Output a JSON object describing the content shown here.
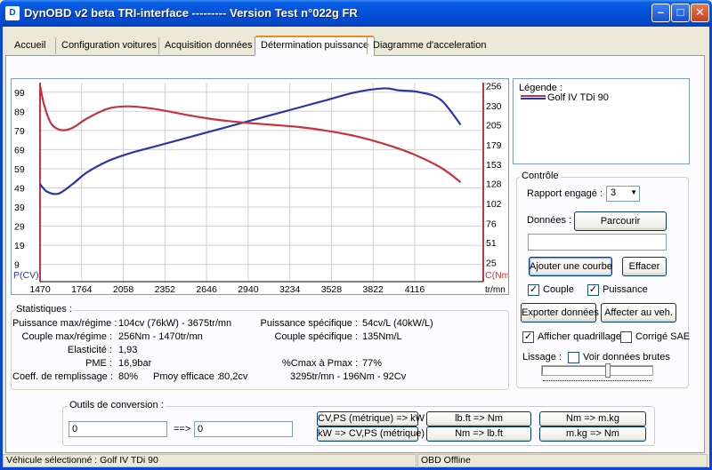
{
  "window": {
    "title": "DynOBD v2 beta TRI-interface --------- Version Test n°022g FR",
    "app_icon": "dyno-app-icon"
  },
  "tabs": [
    {
      "label": "Accueil"
    },
    {
      "label": "Configuration voitures"
    },
    {
      "label": "Acquisition données"
    },
    {
      "label": "Détermination puissance",
      "active": true
    },
    {
      "label": "Diagramme d'acceleration"
    }
  ],
  "chart_data": {
    "type": "line",
    "x_ticks": [
      1470,
      1764,
      2058,
      2352,
      2646,
      2940,
      3234,
      3528,
      3822,
      4116
    ],
    "x_unit": "tr/mn",
    "y_left_ticks": [
      99,
      89,
      79,
      69,
      59,
      49,
      39,
      29,
      19,
      9
    ],
    "y_left_label": "P(CV)",
    "y_right_ticks": [
      256,
      230,
      205,
      179,
      153,
      128,
      102,
      76,
      51,
      25
    ],
    "y_right_label": "C(Nm)",
    "xlim": [
      1470,
      4600
    ],
    "ylim_left": [
      0,
      104
    ],
    "ylim_right": [
      0,
      260
    ],
    "series": [
      {
        "color": "#2c36a8",
        "axis": "left",
        "x": [
          1470,
          1520,
          1600,
          1700,
          1800,
          1950,
          2100,
          2300,
          2500,
          2700,
          2900,
          3100,
          3300,
          3500,
          3700,
          3900,
          4000,
          4150,
          4300,
          4440
        ],
        "y": [
          51,
          47,
          46,
          51,
          57,
          63,
          67,
          71,
          75,
          79,
          83,
          87,
          91,
          95,
          99,
          101,
          100,
          99,
          95,
          82
        ]
      },
      {
        "color": "#c8323c",
        "axis": "right",
        "x": [
          1470,
          1500,
          1550,
          1620,
          1700,
          1800,
          1950,
          2100,
          2300,
          2500,
          2700,
          2900,
          3100,
          3300,
          3500,
          3700,
          3900,
          4100,
          4300,
          4440
        ],
        "y": [
          256,
          230,
          206,
          198,
          201,
          213,
          226,
          229,
          225,
          218,
          212,
          208,
          205,
          202,
          197,
          190,
          180,
          167,
          149,
          130
        ]
      }
    ]
  },
  "legend": {
    "title": "Légende :",
    "entry": "Golf IV TDi 90"
  },
  "controle": {
    "title": "Contrôle",
    "rapport_label": "Rapport engagé :",
    "rapport_value": "3",
    "donnees_label": "Données :",
    "parcourir": "Parcourir",
    "file_value": "",
    "ajouter": "Ajouter une courbe",
    "effacer": "Effacer",
    "couple_label": "Couple",
    "couple_checked": true,
    "puissance_label": "Puissance",
    "puissance_checked": true,
    "exporter": "Exporter données",
    "affecter": "Affecter au veh.",
    "quadrillage_label": "Afficher quadrillage",
    "quadrillage_checked": true,
    "sae_label": "Corrigé SAE",
    "sae_checked": false,
    "lissage_label": "Lissage :",
    "brutes_label": "Voir données brutes",
    "brutes_checked": false
  },
  "stats": {
    "title": "Statistiques :",
    "puissance_max_label": "Puissance max/régime :",
    "puissance_max": "104cv (76kW) - 3675tr/mn",
    "couple_max_label": "Couple max/régime :",
    "couple_max": "256Nm - 1470tr/mn",
    "elasticite_label": "Elasticité :",
    "elasticite": "1,93",
    "pme_label": "PME :",
    "pme": "16,9bar",
    "coeff_label": "Coeff. de remplissage :",
    "coeff": "80%",
    "pmoy_label": "Pmoy efficace :",
    "pmoy": "80,2cv",
    "puiss_spec_label": "Puissance spécifique :",
    "puiss_spec": "54cv/L (40kW/L)",
    "couple_spec_label": "Couple spécifique :",
    "couple_spec": "135Nm/L",
    "cmax_pmax_label": "%Cmax à Pmax :",
    "cmax_pmax": "77%",
    "extra": "3295tr/mn - 196Nm - 92Cv"
  },
  "conversion": {
    "title": "Outils de conversion :",
    "input_value": "0",
    "arrow": "==>",
    "output_value": "0",
    "btn_cv_kw": "CV,PS (métrique) => kW",
    "btn_kw_cv": "kW => CV,PS (métrique)",
    "btn_lbft_nm": "lb.ft => Nm",
    "btn_nm_lbft": "Nm => lb.ft",
    "btn_nm_mkg": "Nm => m.kg",
    "btn_mkg_nm": "m.kg => Nm"
  },
  "statusbar": {
    "vehicule": "Véhicule sélectionné : Golf IV TDi 90",
    "obd": "OBD Offline"
  }
}
